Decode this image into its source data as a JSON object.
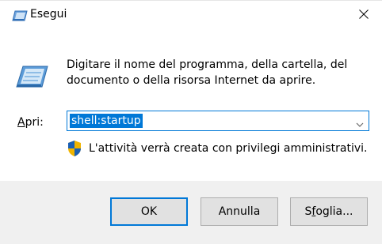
{
  "window": {
    "title": "Esegui",
    "title_icon": "run-dialog-icon",
    "close_icon": "close-icon"
  },
  "main": {
    "icon": "run-program-icon",
    "instructions": "Digitare il nome del programma, della cartella, del documento o della risorsa Internet da aprire.",
    "open_label": "Apri:",
    "open_value": "shell:startup",
    "admin_note": "L'attività verrà creata con privilegi amministrativi.",
    "admin_icon": "uac-shield-icon"
  },
  "buttons": {
    "ok": "OK",
    "cancel": "Annulla",
    "browse": "Sfoglia..."
  },
  "colors": {
    "accent": "#0078d7",
    "footer_bg": "#f0f0f0",
    "button_bg": "#e1e1e1"
  }
}
